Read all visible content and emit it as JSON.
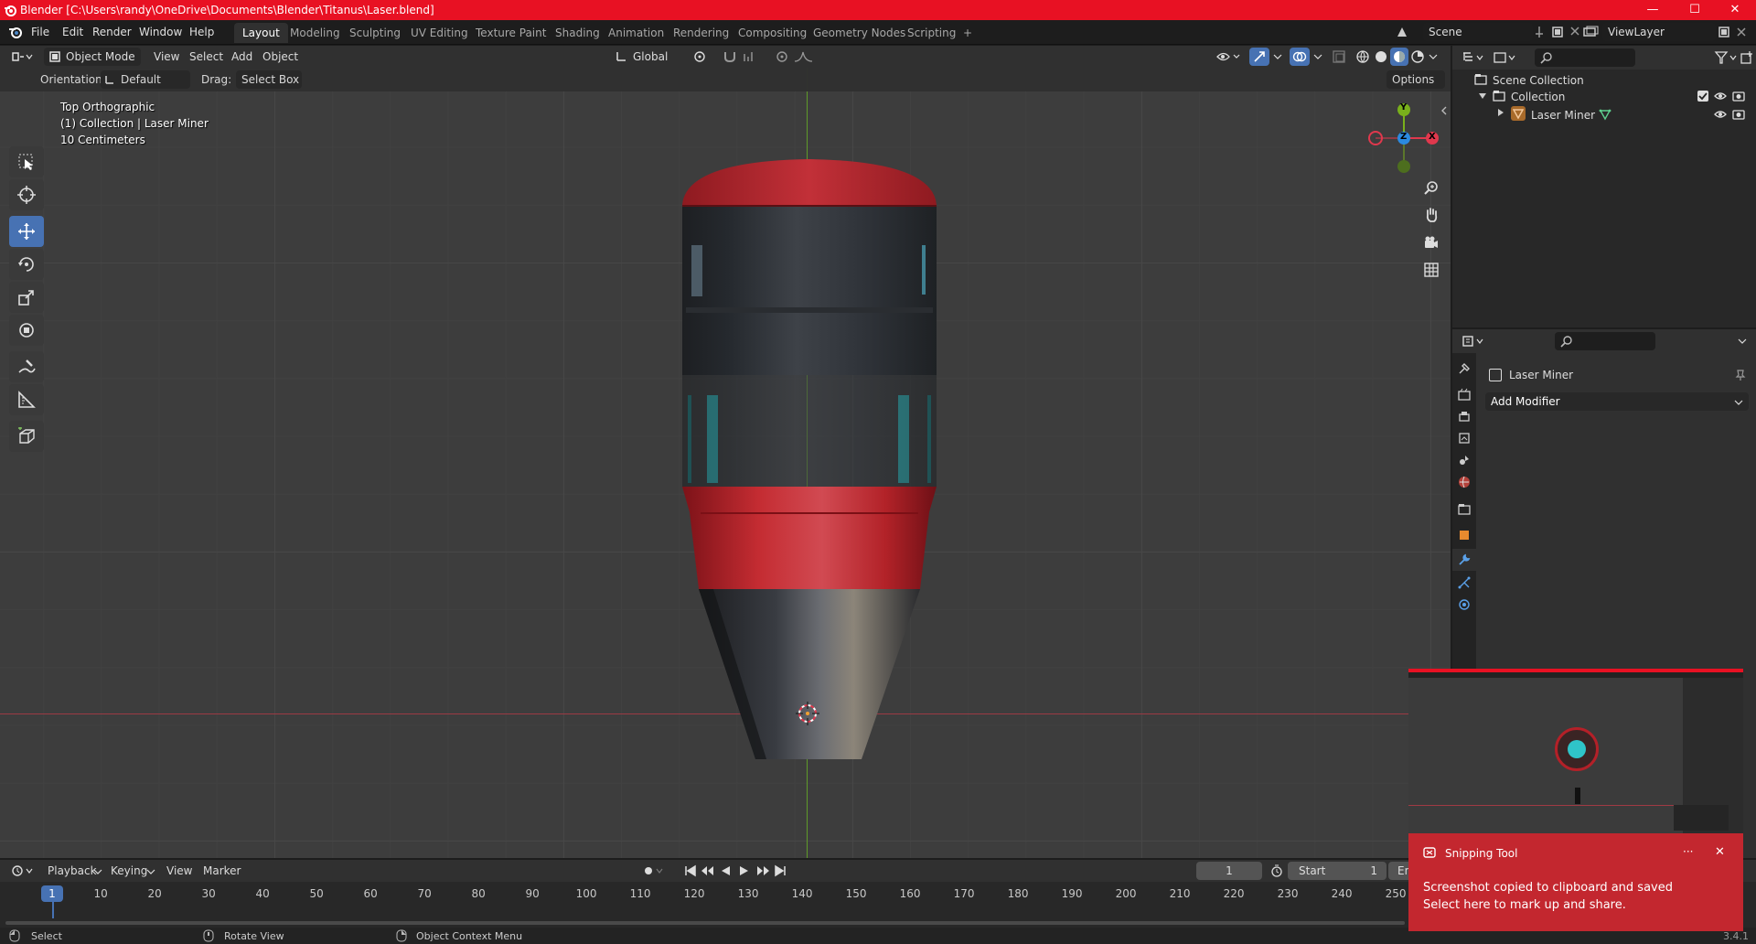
{
  "titlebar": {
    "title": "Blender [C:\\Users\\randy\\OneDrive\\Documents\\Blender\\Titanus\\Laser.blend]",
    "minimize": "—",
    "maximize": "☐",
    "close": "✕"
  },
  "menu": [
    "File",
    "Edit",
    "Render",
    "Window",
    "Help"
  ],
  "workspaces": [
    "Layout",
    "Modeling",
    "Sculpting",
    "UV Editing",
    "Texture Paint",
    "Shading",
    "Animation",
    "Rendering",
    "Compositing",
    "Geometry Nodes",
    "Scripting"
  ],
  "workspace_add": "+",
  "scene": {
    "name": "Scene"
  },
  "view_layer": {
    "name": "ViewLayer"
  },
  "viewport_header": {
    "mode": "Object Mode",
    "menus": [
      "View",
      "Select",
      "Add",
      "Object"
    ],
    "transform_orientation": "Global",
    "options": "Options"
  },
  "tool_header": {
    "orientation_label": "Orientation:",
    "orientation_value": "Default",
    "drag_label": "Drag:",
    "drag_value": "Select Box"
  },
  "viewport": {
    "view_name": "Top Orthographic",
    "collection_info": "(1) Collection | Laser Miner",
    "scale": "10 Centimeters",
    "gizmo": {
      "y": "Y",
      "z": "Z",
      "x": "X"
    }
  },
  "outliner": {
    "items": [
      {
        "label": "Scene Collection"
      },
      {
        "label": "Collection"
      },
      {
        "label": "Laser Miner"
      }
    ]
  },
  "properties": {
    "object_name": "Laser Miner",
    "add_modifier": "Add Modifier"
  },
  "timeline": {
    "menus": [
      "Playback",
      "Keying",
      "View",
      "Marker"
    ],
    "current_frame": "1",
    "start_label": "Start",
    "start_value": "1",
    "end_label": "End",
    "ticks": [
      "1",
      "10",
      "20",
      "30",
      "40",
      "50",
      "60",
      "70",
      "80",
      "90",
      "100",
      "110",
      "120",
      "130",
      "140",
      "150",
      "160",
      "170",
      "180",
      "190",
      "200",
      "210",
      "220",
      "230",
      "240",
      "250"
    ]
  },
  "statusbar": {
    "select": "Select",
    "rotate": "Rotate View",
    "context": "Object Context Menu",
    "version": "3.4.1"
  },
  "toast": {
    "app": "Snipping Tool",
    "more": "···",
    "close": "✕",
    "message": "Screenshot copied to clipboard and saved",
    "sub": "Select here to mark up and share."
  },
  "colors": {
    "titlebar": "#e81123",
    "accent_blue": "#4772b3",
    "x_axis": "#e0384d",
    "y_axis": "#79b01b",
    "z_axis": "#2b8ae0",
    "toast_bg": "#c3272f",
    "model_red": "#b42028",
    "model_cyan": "#2fc4c8"
  }
}
